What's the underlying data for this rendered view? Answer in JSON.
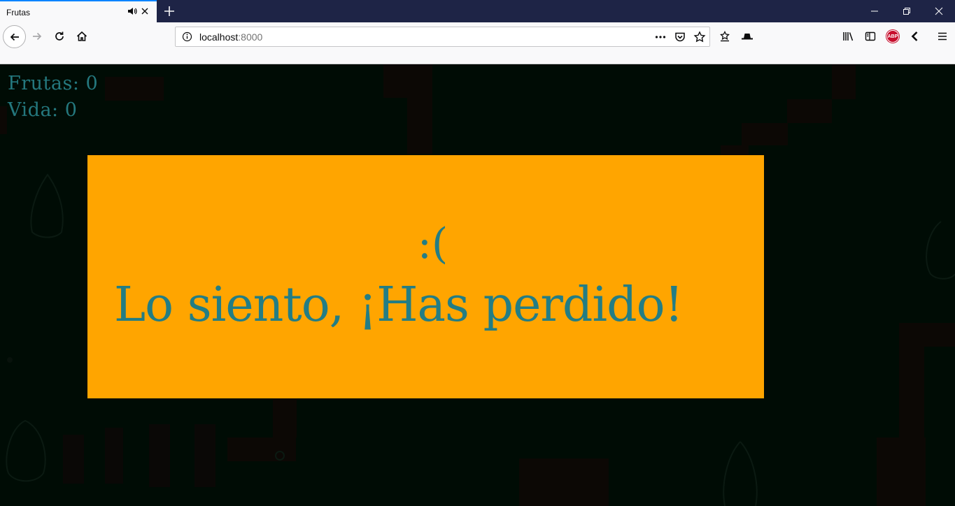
{
  "browser": {
    "tab": {
      "title": "Frutas"
    },
    "url": {
      "host": "localhost",
      "port": ":8000"
    },
    "addon_badge": "ABP"
  },
  "game": {
    "hud": {
      "frutas_label": "Frutas: 0",
      "vida_label": "Vida: 0"
    },
    "dialog": {
      "face": ":(",
      "message": "Lo siento, ¡Has perdido!"
    }
  },
  "colors": {
    "panel": "#ffa500",
    "text": "#237d84",
    "background": "#000c05",
    "tab_accent": "#0a84ff"
  }
}
